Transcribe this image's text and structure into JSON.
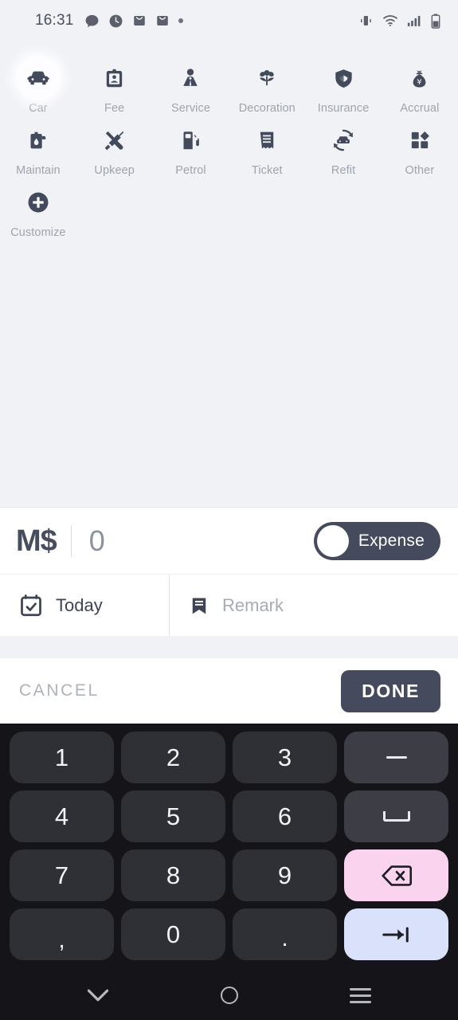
{
  "status_bar": {
    "time": "16:31",
    "left_icons": [
      "chat-bubble-icon",
      "clock-icon",
      "mail-icon",
      "mail-icon",
      "dot-icon"
    ],
    "right_icons": [
      "vibrate-icon",
      "wifi-icon",
      "signal-icon",
      "battery-icon"
    ]
  },
  "categories": [
    {
      "label": "Car",
      "icon": "car-icon",
      "selected": true
    },
    {
      "label": "Fee",
      "icon": "badge-icon",
      "selected": false
    },
    {
      "label": "Service",
      "icon": "person-tie-icon",
      "selected": false
    },
    {
      "label": "Decoration",
      "icon": "flower-icon",
      "selected": false
    },
    {
      "label": "Insurance",
      "icon": "shield-icon",
      "selected": false
    },
    {
      "label": "Accrual",
      "icon": "money-bag-icon",
      "selected": false
    },
    {
      "label": "Maintain",
      "icon": "oil-can-icon",
      "selected": false
    },
    {
      "label": "Upkeep",
      "icon": "tools-icon",
      "selected": false
    },
    {
      "label": "Petrol",
      "icon": "fuel-pump-icon",
      "selected": false
    },
    {
      "label": "Ticket",
      "icon": "receipt-icon",
      "selected": false
    },
    {
      "label": "Refit",
      "icon": "car-refresh-icon",
      "selected": false
    },
    {
      "label": "Other",
      "icon": "grid-shapes-icon",
      "selected": false
    },
    {
      "label": "Customize",
      "icon": "plus-circle-icon",
      "selected": false
    }
  ],
  "amount": {
    "currency": "M$",
    "value": "0",
    "toggle_label": "Expense",
    "toggle_state": "off"
  },
  "meta": {
    "date_icon": "calendar-check-icon",
    "date_label": "Today",
    "remark_icon": "bookmark-icon",
    "remark_placeholder": "Remark"
  },
  "actions": {
    "cancel_label": "CANCEL",
    "done_label": "DONE"
  },
  "keyboard": {
    "rows": [
      [
        {
          "label": "1",
          "name": "key-1",
          "type": "digit"
        },
        {
          "label": "2",
          "name": "key-2",
          "type": "digit"
        },
        {
          "label": "3",
          "name": "key-3",
          "type": "digit"
        },
        {
          "label": "−",
          "name": "key-minus",
          "type": "func"
        }
      ],
      [
        {
          "label": "4",
          "name": "key-4",
          "type": "digit"
        },
        {
          "label": "5",
          "name": "key-5",
          "type": "digit"
        },
        {
          "label": "6",
          "name": "key-6",
          "type": "digit"
        },
        {
          "label": "␣",
          "name": "key-space",
          "type": "func"
        }
      ],
      [
        {
          "label": "7",
          "name": "key-7",
          "type": "digit"
        },
        {
          "label": "8",
          "name": "key-8",
          "type": "digit"
        },
        {
          "label": "9",
          "name": "key-9",
          "type": "digit"
        },
        {
          "label": "⌫",
          "name": "key-backspace",
          "type": "pink"
        }
      ],
      [
        {
          "label": ",",
          "name": "key-comma",
          "type": "digit"
        },
        {
          "label": "0",
          "name": "key-0",
          "type": "digit"
        },
        {
          "label": ".",
          "name": "key-period",
          "type": "digit"
        },
        {
          "label": "→|",
          "name": "key-enter",
          "type": "blue"
        }
      ]
    ]
  },
  "navbar": {
    "back_icon": "chevron-down-icon",
    "home_icon": "circle-home-icon",
    "recents_icon": "hamburger-recents-icon"
  },
  "colors": {
    "panel_bg": "#f1f2f6",
    "surface": "#ffffff",
    "accent_dark": "#454b5c",
    "muted_text": "#9ea3ad",
    "keyboard_bg": "#151519",
    "key_bg": "#2f3035",
    "key_func_bg": "#3d3e45",
    "key_pink": "#fad3ef",
    "key_blue": "#dae1fb"
  }
}
